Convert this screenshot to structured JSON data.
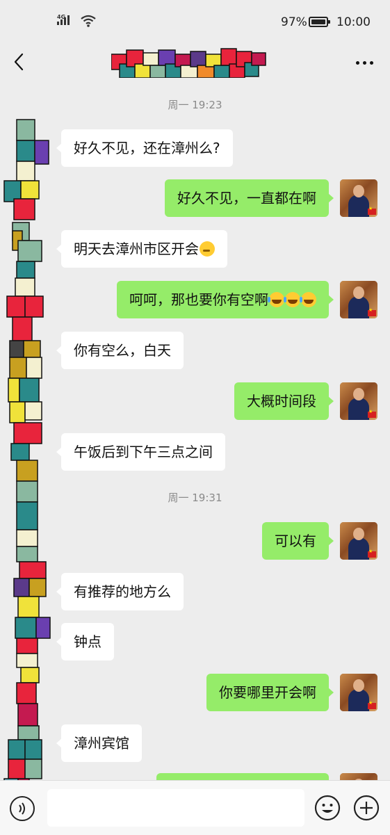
{
  "status_bar": {
    "network": "4G",
    "battery_pct": "97%",
    "battery_level": 0.97,
    "time": "10:00"
  },
  "header": {
    "back_icon": "chevron-left-icon",
    "more_icon": "more-horizontal-icon",
    "contact_name_obscured": true
  },
  "messages": [
    {
      "kind": "time",
      "text": "周一 19:23"
    },
    {
      "kind": "in",
      "text": "好久不见，还在漳州么?"
    },
    {
      "kind": "out",
      "text": "好久不见，一直都在啊"
    },
    {
      "kind": "in",
      "text": "明天去漳州市区开会",
      "emoji": [
        "thinking-face"
      ]
    },
    {
      "kind": "out",
      "text": "呵呵，那也要你有空啊",
      "emoji": [
        "rofl",
        "rofl",
        "rofl"
      ]
    },
    {
      "kind": "in",
      "text": "你有空么，白天"
    },
    {
      "kind": "out",
      "text": "大概时间段"
    },
    {
      "kind": "in",
      "text": "午饭后到下午三点之间"
    },
    {
      "kind": "time",
      "text": "周一 19:31"
    },
    {
      "kind": "out",
      "text": "可以有"
    },
    {
      "kind": "in",
      "text": "有推荐的地方么"
    },
    {
      "kind": "in",
      "text": "钟点"
    },
    {
      "kind": "out",
      "text": "你要哪里开会啊"
    },
    {
      "kind": "in",
      "text": "漳州宾馆"
    },
    {
      "kind": "out",
      "text": ""
    }
  ],
  "input_bar": {
    "voice_icon": "voice-icon",
    "text_value": "",
    "emoji_icon": "emoji-icon",
    "plus_icon": "plus-icon"
  },
  "colors": {
    "background": "#ededed",
    "incoming_bubble": "#ffffff",
    "outgoing_bubble": "#95ec69",
    "timestamp": "#8a8a8a"
  }
}
